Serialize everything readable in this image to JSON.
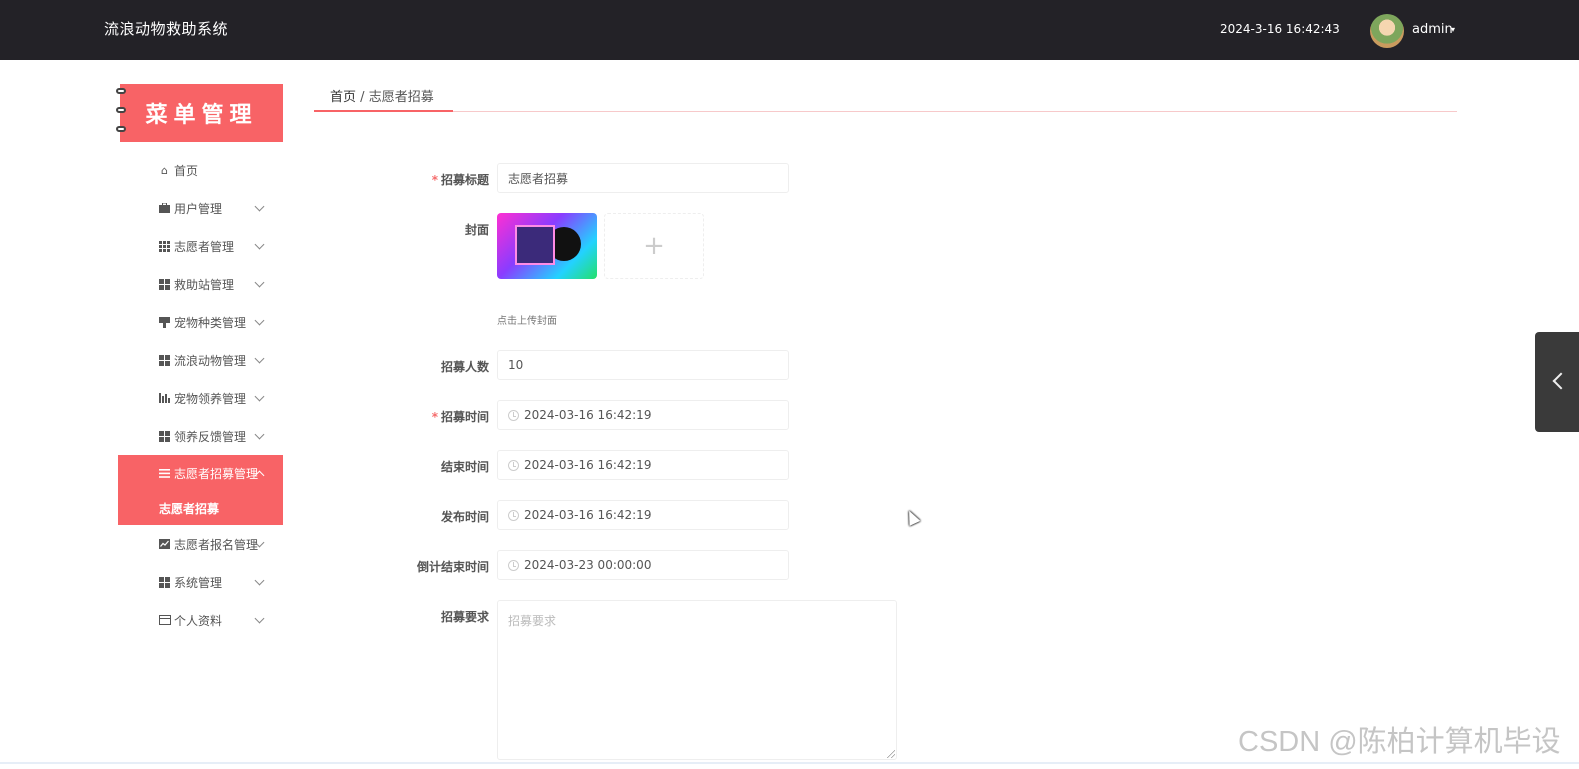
{
  "header": {
    "app_title": "流浪动物救助系统",
    "datetime": "2024-3-16 16:42:43",
    "user_name": "admin",
    "caret": "▾"
  },
  "sidebar": {
    "banner": "菜单管理",
    "items": [
      {
        "label": "首页",
        "icon": "home-icon"
      },
      {
        "label": "用户管理",
        "icon": "briefcase-icon"
      },
      {
        "label": "志愿者管理",
        "icon": "grid-icon"
      },
      {
        "label": "救助站管理",
        "icon": "grid-icon"
      },
      {
        "label": "宠物种类管理",
        "icon": "stamp-icon"
      },
      {
        "label": "流浪动物管理",
        "icon": "grid-icon"
      },
      {
        "label": "宠物领养管理",
        "icon": "chart-icon"
      },
      {
        "label": "领养反馈管理",
        "icon": "grid-icon"
      },
      {
        "label": "志愿者招募管理",
        "icon": "list-icon"
      },
      {
        "label": "志愿者报名管理",
        "icon": "trend-icon"
      },
      {
        "label": "系统管理",
        "icon": "grid-icon"
      },
      {
        "label": "个人资料",
        "icon": "card-icon"
      }
    ],
    "submenu": {
      "label": "志愿者招募"
    }
  },
  "breadcrumb": {
    "home": "首页",
    "separator": "/",
    "current": "志愿者招募"
  },
  "form": {
    "title_label": "招募标题",
    "title_value": "志愿者招募",
    "cover_label": "封面",
    "upload_plus": "+",
    "upload_hint": "点击上传封面",
    "count_label": "招募人数",
    "count_value": "10",
    "recruit_time_label": "招募时间",
    "recruit_time_value": "2024-03-16 16:42:19",
    "end_time_label": "结束时间",
    "end_time_value": "2024-03-16 16:42:19",
    "publish_time_label": "发布时间",
    "publish_time_value": "2024-03-16 16:42:19",
    "countdown_label": "倒计结束时间",
    "countdown_value": "2024-03-23 00:00:00",
    "requirement_label": "招募要求",
    "requirement_placeholder": "招募要求",
    "required_mark": "*"
  },
  "watermark": "CSDN @陈柏计算机毕设",
  "colors": {
    "topbar": "#232227",
    "accent": "#f86366",
    "required": "#f56c6c"
  }
}
